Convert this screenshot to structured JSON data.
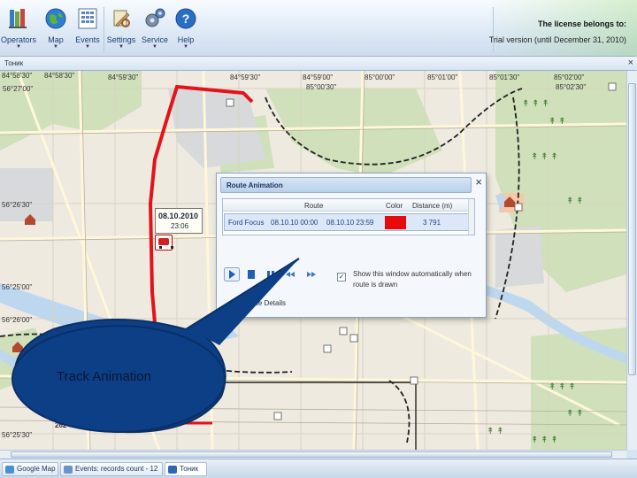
{
  "toolbar": {
    "buttons": [
      {
        "label": "Operators",
        "icon": "operators-books-icon"
      },
      {
        "label": "Map",
        "icon": "globe-icon"
      },
      {
        "label": "Events",
        "icon": "calendar-grid-icon"
      },
      {
        "label": "Settings",
        "icon": "settings-tools-icon"
      },
      {
        "label": "Service",
        "icon": "gears-icon"
      },
      {
        "label": "Help",
        "icon": "help-question-icon"
      }
    ],
    "dropdown_glyph": "▼"
  },
  "license": {
    "title": "The license belongs to:",
    "detail": "Trial version (until December 31, 2010)"
  },
  "map_window": {
    "title": "Тоник",
    "close_glyph": "×"
  },
  "map": {
    "coords_top": [
      "84°58'30\"",
      "84°58'30\"",
      "84°59'30\"",
      "84°59'30\"",
      "84°59'00\"",
      "85°00'00\"",
      "85°00'30\"",
      "85°01'00\"",
      "85°01'30\"",
      "85°02'00\"",
      "85°02'30\""
    ],
    "coords_left": [
      "56°27'00\"",
      "56°26'30\"",
      "56°26'00\"",
      "56°25'30\"",
      "56°25'00\""
    ],
    "route_label": {
      "date": "08.10.2010",
      "time": "23:06"
    },
    "bottom_text": "262"
  },
  "route_dialog": {
    "title": "Route Animation",
    "close_glyph": "×",
    "columns": [
      "Route",
      "Color",
      "Distance (m)"
    ],
    "row": {
      "vehicle": "Ford Focus",
      "start": "08.10.10 00:00",
      "end": "08.10.10 23:59",
      "color": "#e80a0a",
      "distance": "3 791"
    },
    "controls": [
      "play-icon",
      "pause-icon",
      "stop-icon",
      "rewind-icon",
      "fast-forward-icon"
    ],
    "auto_show_checked": true,
    "auto_show_label": "Show this window automatically when route is drawn",
    "details_label": "Route Details"
  },
  "callout": {
    "text": "Track Animation"
  },
  "bottom_tabs": [
    {
      "label": "Google Map",
      "icon": "map-tab-icon"
    },
    {
      "label": "Events: records count - 12",
      "icon": "events-tab-icon"
    },
    {
      "label": "Тоник",
      "icon": "tonik-tab-icon"
    }
  ]
}
